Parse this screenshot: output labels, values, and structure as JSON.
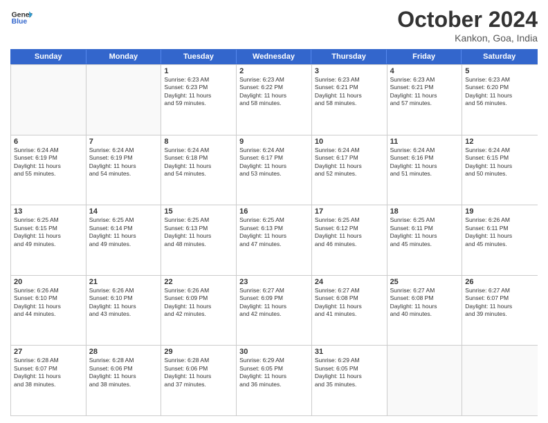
{
  "header": {
    "logo_line1": "General",
    "logo_line2": "Blue",
    "month": "October 2024",
    "location": "Kankon, Goa, India"
  },
  "days_of_week": [
    "Sunday",
    "Monday",
    "Tuesday",
    "Wednesday",
    "Thursday",
    "Friday",
    "Saturday"
  ],
  "weeks": [
    [
      {
        "day": "",
        "lines": []
      },
      {
        "day": "",
        "lines": []
      },
      {
        "day": "1",
        "lines": [
          "Sunrise: 6:23 AM",
          "Sunset: 6:23 PM",
          "Daylight: 11 hours",
          "and 59 minutes."
        ]
      },
      {
        "day": "2",
        "lines": [
          "Sunrise: 6:23 AM",
          "Sunset: 6:22 PM",
          "Daylight: 11 hours",
          "and 58 minutes."
        ]
      },
      {
        "day": "3",
        "lines": [
          "Sunrise: 6:23 AM",
          "Sunset: 6:21 PM",
          "Daylight: 11 hours",
          "and 58 minutes."
        ]
      },
      {
        "day": "4",
        "lines": [
          "Sunrise: 6:23 AM",
          "Sunset: 6:21 PM",
          "Daylight: 11 hours",
          "and 57 minutes."
        ]
      },
      {
        "day": "5",
        "lines": [
          "Sunrise: 6:23 AM",
          "Sunset: 6:20 PM",
          "Daylight: 11 hours",
          "and 56 minutes."
        ]
      }
    ],
    [
      {
        "day": "6",
        "lines": [
          "Sunrise: 6:24 AM",
          "Sunset: 6:19 PM",
          "Daylight: 11 hours",
          "and 55 minutes."
        ]
      },
      {
        "day": "7",
        "lines": [
          "Sunrise: 6:24 AM",
          "Sunset: 6:19 PM",
          "Daylight: 11 hours",
          "and 54 minutes."
        ]
      },
      {
        "day": "8",
        "lines": [
          "Sunrise: 6:24 AM",
          "Sunset: 6:18 PM",
          "Daylight: 11 hours",
          "and 54 minutes."
        ]
      },
      {
        "day": "9",
        "lines": [
          "Sunrise: 6:24 AM",
          "Sunset: 6:17 PM",
          "Daylight: 11 hours",
          "and 53 minutes."
        ]
      },
      {
        "day": "10",
        "lines": [
          "Sunrise: 6:24 AM",
          "Sunset: 6:17 PM",
          "Daylight: 11 hours",
          "and 52 minutes."
        ]
      },
      {
        "day": "11",
        "lines": [
          "Sunrise: 6:24 AM",
          "Sunset: 6:16 PM",
          "Daylight: 11 hours",
          "and 51 minutes."
        ]
      },
      {
        "day": "12",
        "lines": [
          "Sunrise: 6:24 AM",
          "Sunset: 6:15 PM",
          "Daylight: 11 hours",
          "and 50 minutes."
        ]
      }
    ],
    [
      {
        "day": "13",
        "lines": [
          "Sunrise: 6:25 AM",
          "Sunset: 6:15 PM",
          "Daylight: 11 hours",
          "and 49 minutes."
        ]
      },
      {
        "day": "14",
        "lines": [
          "Sunrise: 6:25 AM",
          "Sunset: 6:14 PM",
          "Daylight: 11 hours",
          "and 49 minutes."
        ]
      },
      {
        "day": "15",
        "lines": [
          "Sunrise: 6:25 AM",
          "Sunset: 6:13 PM",
          "Daylight: 11 hours",
          "and 48 minutes."
        ]
      },
      {
        "day": "16",
        "lines": [
          "Sunrise: 6:25 AM",
          "Sunset: 6:13 PM",
          "Daylight: 11 hours",
          "and 47 minutes."
        ]
      },
      {
        "day": "17",
        "lines": [
          "Sunrise: 6:25 AM",
          "Sunset: 6:12 PM",
          "Daylight: 11 hours",
          "and 46 minutes."
        ]
      },
      {
        "day": "18",
        "lines": [
          "Sunrise: 6:25 AM",
          "Sunset: 6:11 PM",
          "Daylight: 11 hours",
          "and 45 minutes."
        ]
      },
      {
        "day": "19",
        "lines": [
          "Sunrise: 6:26 AM",
          "Sunset: 6:11 PM",
          "Daylight: 11 hours",
          "and 45 minutes."
        ]
      }
    ],
    [
      {
        "day": "20",
        "lines": [
          "Sunrise: 6:26 AM",
          "Sunset: 6:10 PM",
          "Daylight: 11 hours",
          "and 44 minutes."
        ]
      },
      {
        "day": "21",
        "lines": [
          "Sunrise: 6:26 AM",
          "Sunset: 6:10 PM",
          "Daylight: 11 hours",
          "and 43 minutes."
        ]
      },
      {
        "day": "22",
        "lines": [
          "Sunrise: 6:26 AM",
          "Sunset: 6:09 PM",
          "Daylight: 11 hours",
          "and 42 minutes."
        ]
      },
      {
        "day": "23",
        "lines": [
          "Sunrise: 6:27 AM",
          "Sunset: 6:09 PM",
          "Daylight: 11 hours",
          "and 42 minutes."
        ]
      },
      {
        "day": "24",
        "lines": [
          "Sunrise: 6:27 AM",
          "Sunset: 6:08 PM",
          "Daylight: 11 hours",
          "and 41 minutes."
        ]
      },
      {
        "day": "25",
        "lines": [
          "Sunrise: 6:27 AM",
          "Sunset: 6:08 PM",
          "Daylight: 11 hours",
          "and 40 minutes."
        ]
      },
      {
        "day": "26",
        "lines": [
          "Sunrise: 6:27 AM",
          "Sunset: 6:07 PM",
          "Daylight: 11 hours",
          "and 39 minutes."
        ]
      }
    ],
    [
      {
        "day": "27",
        "lines": [
          "Sunrise: 6:28 AM",
          "Sunset: 6:07 PM",
          "Daylight: 11 hours",
          "and 38 minutes."
        ]
      },
      {
        "day": "28",
        "lines": [
          "Sunrise: 6:28 AM",
          "Sunset: 6:06 PM",
          "Daylight: 11 hours",
          "and 38 minutes."
        ]
      },
      {
        "day": "29",
        "lines": [
          "Sunrise: 6:28 AM",
          "Sunset: 6:06 PM",
          "Daylight: 11 hours",
          "and 37 minutes."
        ]
      },
      {
        "day": "30",
        "lines": [
          "Sunrise: 6:29 AM",
          "Sunset: 6:05 PM",
          "Daylight: 11 hours",
          "and 36 minutes."
        ]
      },
      {
        "day": "31",
        "lines": [
          "Sunrise: 6:29 AM",
          "Sunset: 6:05 PM",
          "Daylight: 11 hours",
          "and 35 minutes."
        ]
      },
      {
        "day": "",
        "lines": []
      },
      {
        "day": "",
        "lines": []
      }
    ]
  ]
}
